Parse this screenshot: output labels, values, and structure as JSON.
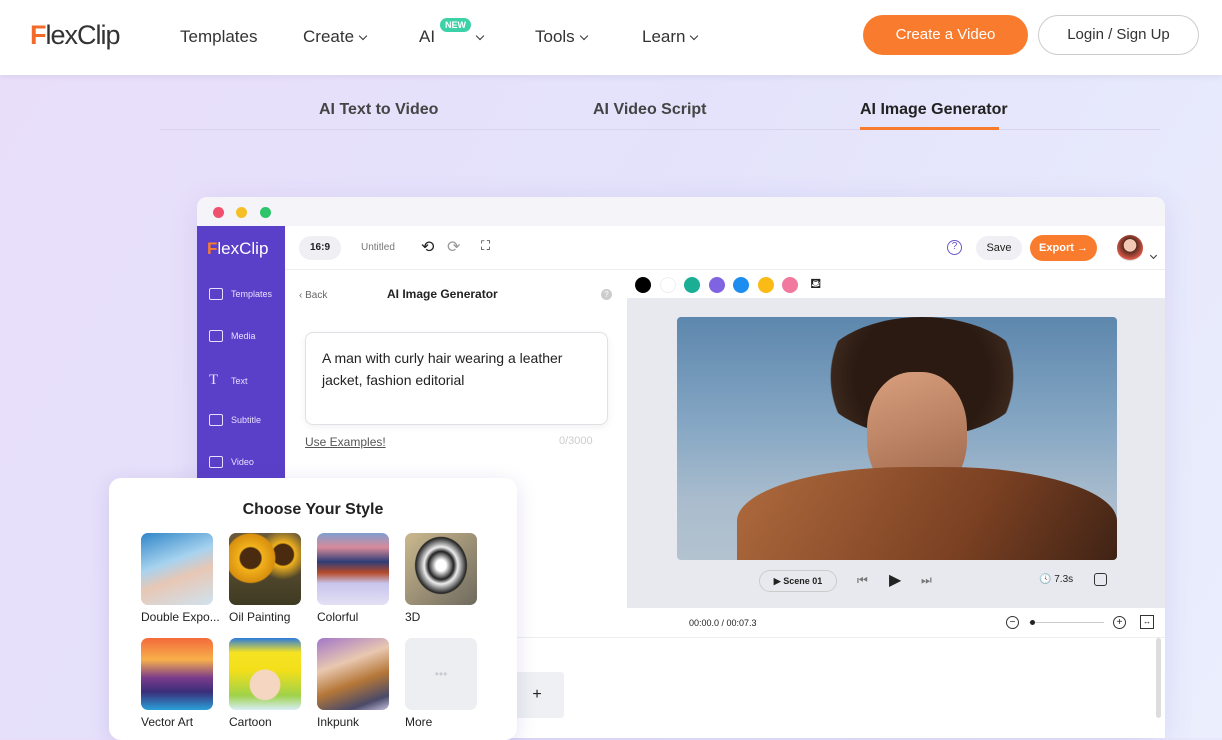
{
  "nav": {
    "logo": "FlexClip",
    "items": [
      {
        "label": "Templates"
      },
      {
        "label": "Create"
      },
      {
        "label": "AI",
        "badge": "NEW"
      },
      {
        "label": "Tools"
      },
      {
        "label": "Learn"
      }
    ],
    "create_button": "Create a Video",
    "login_button": "Login / Sign Up"
  },
  "tabs": [
    {
      "label": "AI Text to Video"
    },
    {
      "label": "AI Video Script"
    },
    {
      "label": "AI Image Generator",
      "active": true
    }
  ],
  "editor": {
    "logo": "FlexClip",
    "sidebar": [
      {
        "label": "Templates",
        "icon": "layers-icon"
      },
      {
        "label": "Media",
        "icon": "folder-icon"
      },
      {
        "label": "Text",
        "icon": "text-icon"
      },
      {
        "label": "Subtitle",
        "icon": "subtitle-icon"
      },
      {
        "label": "Video",
        "icon": "video-icon"
      }
    ],
    "toolbar": {
      "ratio": "16:9",
      "title": "Untitled",
      "save": "Save",
      "export": "Export →"
    },
    "panel": {
      "back": "Back",
      "title": "AI Image Generator",
      "prompt": "A man with curly hair wearing a leather jacket, fashion editorial",
      "examples": "Use Examples!",
      "counter": "0/3000"
    },
    "colors": [
      "#000000",
      "#ffffff",
      "#1aae95",
      "#7f63e0",
      "#1d8ef0",
      "#fbbb17",
      "#f2799e"
    ],
    "player": {
      "scene": "Scene 01",
      "duration": "7.3s",
      "time": "00:00.0 / 00:07.3"
    },
    "add_label": "+"
  },
  "styles": {
    "title": "Choose Your Style",
    "items": [
      {
        "label": "Double Expo..."
      },
      {
        "label": "Oil Painting"
      },
      {
        "label": "Colorful"
      },
      {
        "label": "3D"
      },
      {
        "label": "Vector Art"
      },
      {
        "label": "Cartoon"
      },
      {
        "label": "Inkpunk"
      },
      {
        "label": "More"
      }
    ]
  },
  "accent": "#f97c2e",
  "brand_purple": "#5a3fc8"
}
